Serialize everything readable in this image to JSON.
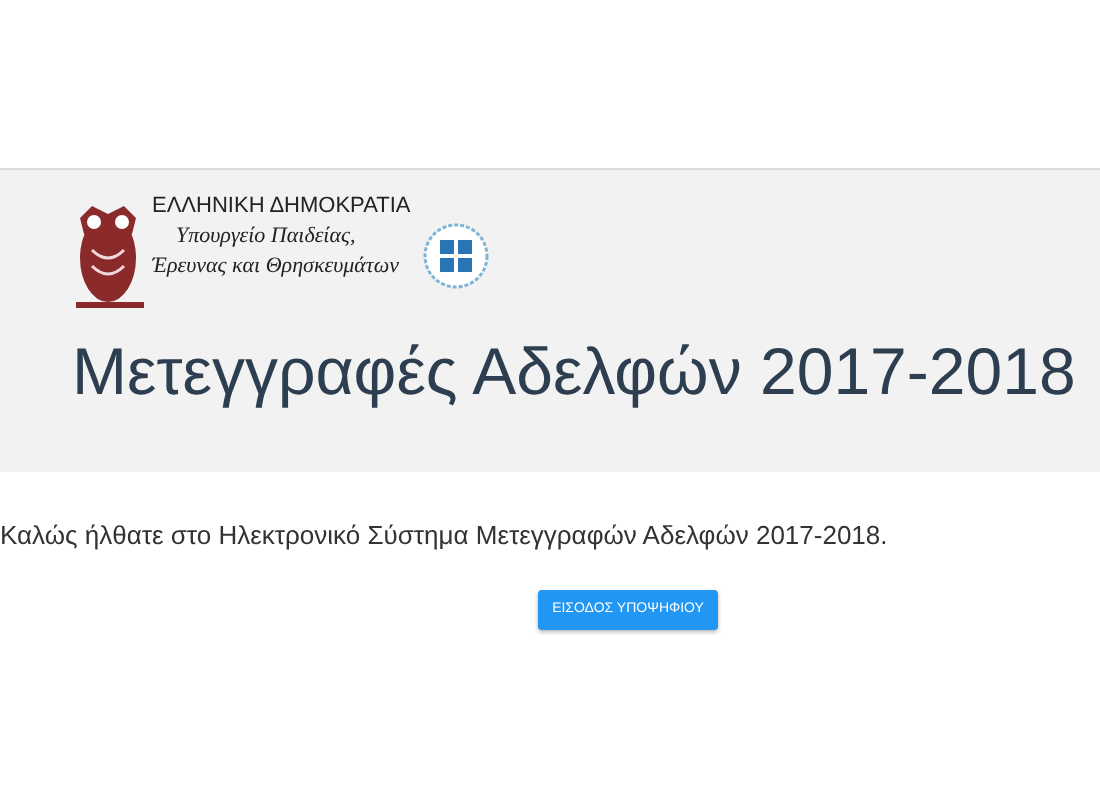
{
  "header": {
    "logo": {
      "country": "ΕΛΛΗΝΙΚΗ ΔΗΜΟΚΡΑΤΙΑ",
      "ministry_lines": [
        "Υπουργείο Παιδείας,",
        "Έρευνας και Θρησκευμάτων"
      ]
    },
    "title": "Μετεγγραφές Αδελφών 2017-2018"
  },
  "welcome": "Καλώς ήλθατε στο Ηλεκτρονικό Σύστημα Μετεγγραφών Αδελφών 2017-2018.",
  "buttons": [
    "ΕΙΣΟΔΟΣ ΥΠΟΨΗΦΙΟΥ"
  ]
}
